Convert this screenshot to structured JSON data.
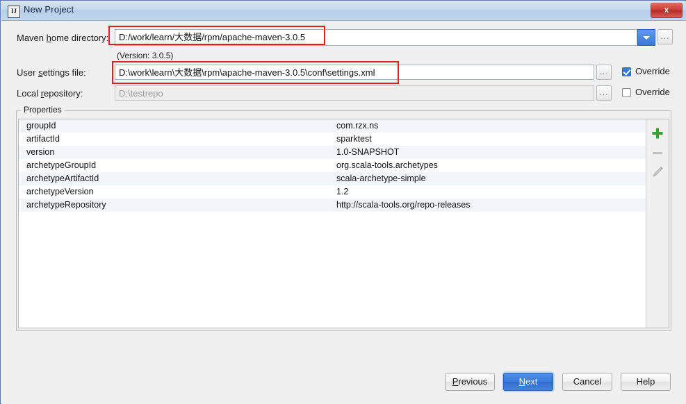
{
  "window": {
    "title": "New Project",
    "icon": "intellij-idea-icon",
    "close_label": "x"
  },
  "form": {
    "maven_home": {
      "label_pre": "Maven ",
      "label_mnemonic": "h",
      "label_post": "ome directory:",
      "value": "D:/work/learn/大数据/rpm/apache-maven-3.0.5",
      "dropdown_icon": "chevron-down-icon",
      "browse_label": "...",
      "version_note": "(Version: 3.0.5)"
    },
    "user_settings": {
      "label_pre": "User ",
      "label_mnemonic": "s",
      "label_post": "ettings file:",
      "value": "D:\\work\\learn\\大数据\\rpm\\apache-maven-3.0.5\\conf\\settings.xml",
      "browse_label": "...",
      "override_label": "Override",
      "override_checked": true
    },
    "local_repository": {
      "label_pre": "Local ",
      "label_mnemonic": "r",
      "label_post": "epository:",
      "value": "D:\\testrepo",
      "disabled": true,
      "browse_label": "...",
      "override_label": "Override",
      "override_checked": false
    }
  },
  "properties": {
    "group_label": "Properties",
    "rows": [
      {
        "key": "groupId",
        "value": "com.rzx.ns"
      },
      {
        "key": "artifactId",
        "value": "sparktest"
      },
      {
        "key": "version",
        "value": "1.0-SNAPSHOT"
      },
      {
        "key": "archetypeGroupId",
        "value": "org.scala-tools.archetypes"
      },
      {
        "key": "archetypeArtifactId",
        "value": "scala-archetype-simple"
      },
      {
        "key": "archetypeVersion",
        "value": "1.2"
      },
      {
        "key": "archetypeRepository",
        "value": "http://scala-tools.org/repo-releases"
      }
    ],
    "toolbar": {
      "add_icon": "plus-icon",
      "remove_icon": "minus-icon",
      "edit_icon": "pencil-icon"
    }
  },
  "footer": {
    "previous": {
      "pre": "",
      "mnemonic": "P",
      "post": "revious"
    },
    "next": {
      "pre": "",
      "mnemonic": "N",
      "post": "ext"
    },
    "cancel": {
      "pre": "Cancel",
      "mnemonic": "",
      "post": ""
    },
    "help": {
      "pre": "Help",
      "mnemonic": "",
      "post": ""
    }
  },
  "colors": {
    "accent_blue": "#3b7bd5",
    "annotation_red": "#e02020",
    "titlebar_blue": "#c4d8ef",
    "close_red": "#c93c33",
    "add_green": "#37a037",
    "row_alt": "#f2f5fa"
  }
}
